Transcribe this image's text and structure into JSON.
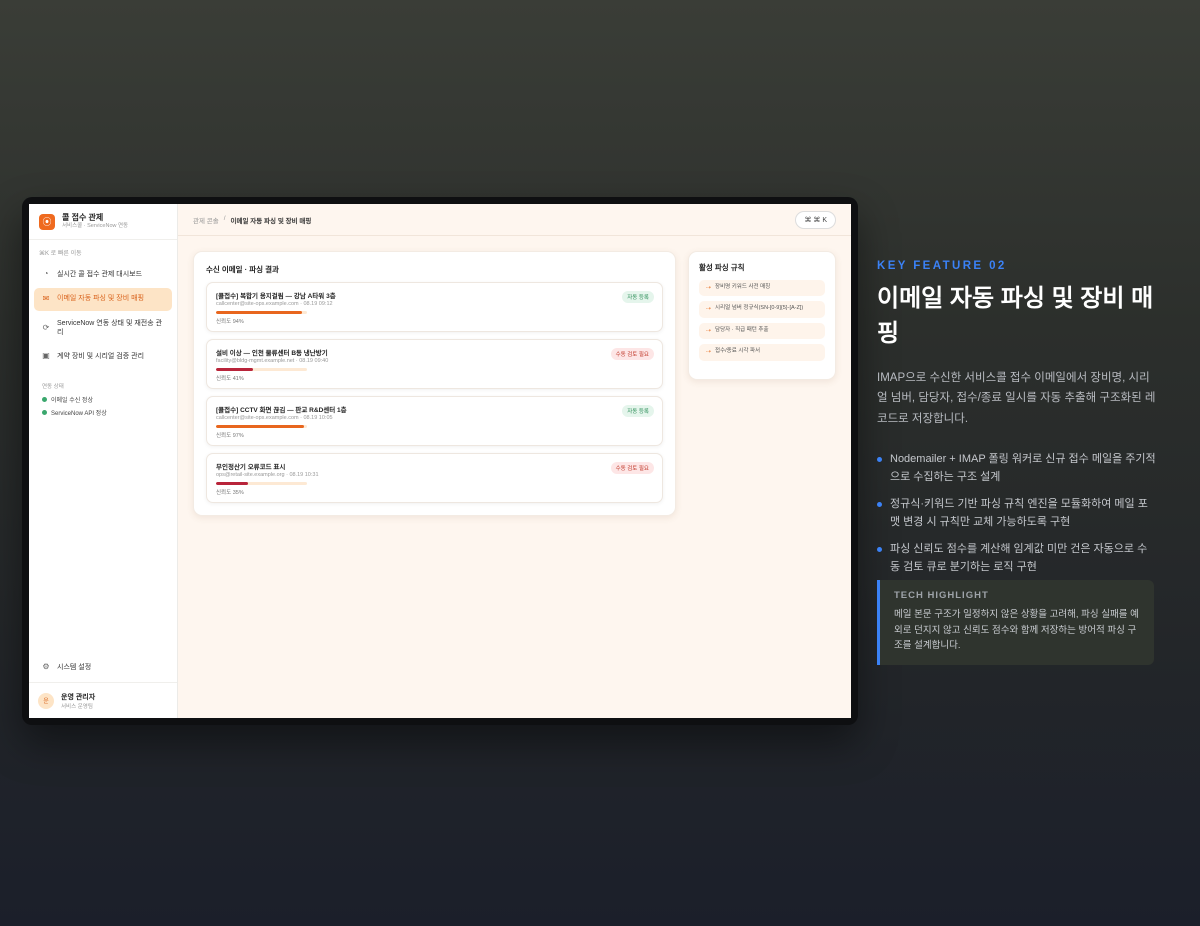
{
  "app": {
    "brand_title": "콜 접수 관제",
    "brand_sub": "서비스콜 · ServiceNow 연동",
    "quick_search": "⌘K 로 빠른 이동"
  },
  "sidebar": {
    "items": [
      {
        "label": "실시간 콜 접수 관제 대시보드",
        "icon": "gauge-icon"
      },
      {
        "label": "이메일 자동 파싱 및 장비 매핑",
        "icon": "mail-icon"
      },
      {
        "label": "ServiceNow 연동 상태 및 재전송 관리",
        "icon": "sync-icon"
      },
      {
        "label": "계약 장비 및 시리얼 검증 관리",
        "icon": "device-icon"
      }
    ],
    "status_heading": "연동 상태",
    "status": [
      "이메일 수신 정상",
      "ServiceNow API 정상"
    ],
    "settings_label": "시스템 설정",
    "user_initial": "운",
    "user_name": "운영 관리자",
    "user_role": "서비스 운영팀"
  },
  "topbar": {
    "crumb_parent": "관제 콘솔",
    "crumb_sep": "/",
    "crumb_current": "이메일 자동 파싱 및 장비 매핑",
    "shortcut": "⌘ ⌘ K"
  },
  "results": {
    "title": "수신 이메일 · 파싱 결과",
    "mails": [
      {
        "subject": "[콜접수] 복합기 용지걸림 — 강남 A타워 3층",
        "meta": "callcenter@site-ops.example.com · 08.19 09:12",
        "confidence_label": "신뢰도 94%",
        "confidence": 0.94,
        "badge": "자동 등록",
        "status": "ok"
      },
      {
        "subject": "설비 이상 — 인천 물류센터 B동 냉난방기",
        "meta": "facility@bldg-mgmt.example.net · 08.19 09:40",
        "confidence_label": "신뢰도 41%",
        "confidence": 0.41,
        "badge": "수동 검토 필요",
        "status": "warn"
      },
      {
        "subject": "[콜접수] CCTV 화면 끊김 — 판교 R&D센터 1층",
        "meta": "callcenter@site-ops.example.com · 08.19 10:05",
        "confidence_label": "신뢰도 97%",
        "confidence": 0.97,
        "badge": "자동 등록",
        "status": "ok"
      },
      {
        "subject": "무인정산기 오류코드 표시",
        "meta": "ops@retail-site.example.org · 08.19 10:31",
        "confidence_label": "신뢰도 35%",
        "confidence": 0.35,
        "badge": "수동 검토 필요",
        "status": "warn"
      }
    ]
  },
  "rules": {
    "title": "활성 파싱 규칙",
    "items": [
      "장비명 키워드 사전 매칭",
      "시리얼 넘버 정규식(SN-[0-9]{5}-[A-Z])",
      "담당자 · 직급 패턴 추출",
      "접수/종료 시각 파서"
    ]
  },
  "feature": {
    "eyebrow": "KEY FEATURE 02",
    "headline": "이메일 자동 파싱 및 장비 매핑",
    "description": "IMAP으로 수신한 서비스콜 접수 이메일에서 장비명, 시리얼 넘버, 담당자, 접수/종료 일시를 자동 추출해 구조화된 레코드로 저장합니다.",
    "points": [
      "Nodemailer + IMAP 폴링 워커로 신규 접수 메일을 주기적으로 수집하는 구조 설계",
      "정규식·키워드 기반 파싱 규칙 엔진을 모듈화하여 메일 포맷 변경 시 규칙만 교체 가능하도록 구현",
      "파싱 신뢰도 점수를 계산해 임계값 미만 건은 자동으로 수동 검토 큐로 분기하는 로직 구현"
    ],
    "tech_title": "TECH HIGHLIGHT",
    "tech_body": "메일 본문 구조가 일정하지 않은 상황을 고려해, 파싱 실패를 예외로 던지지 않고 신뢰도 점수와 함께 저장하는 방어적 파싱 구조를 설계합니다."
  },
  "colors": {
    "accent": "#ef6a1f",
    "bar_high": "#e8661e",
    "bar_low": "#b8243a",
    "feature_blue": "#3b82f6"
  }
}
